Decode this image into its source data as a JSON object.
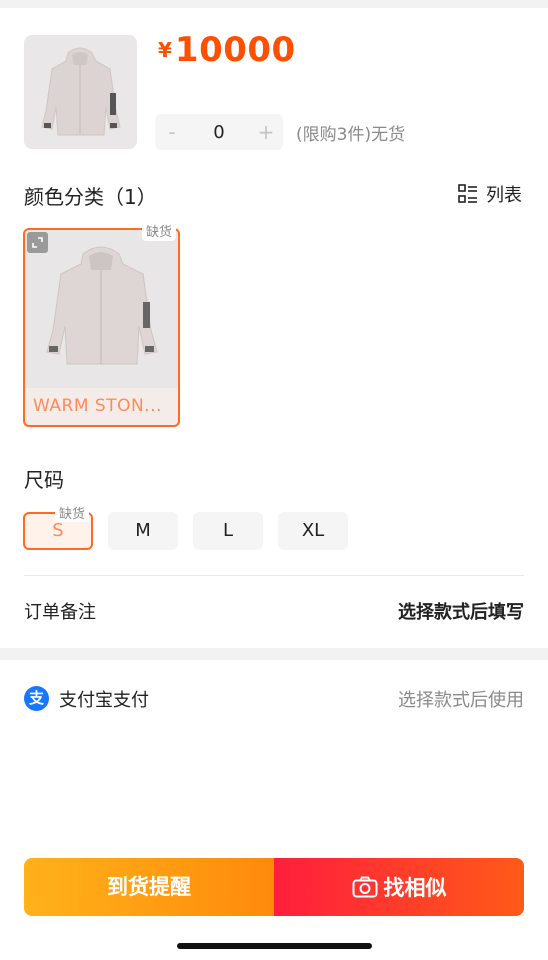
{
  "product": {
    "currency_symbol": "¥",
    "price": "10000",
    "quantity": "0",
    "minus": "-",
    "plus": "+",
    "limit_text": "(限购3件)无货",
    "image_icon": "jacket-thumbnail"
  },
  "color_section": {
    "title": "颜色分类（1）",
    "list_toggle_label": "列表",
    "list_icon": "list-view-icon",
    "items": [
      {
        "label": "WARM STON...",
        "badge": "缺货",
        "selected": true
      }
    ]
  },
  "size_section": {
    "title": "尺码",
    "out_of_stock_badge": "缺货",
    "sizes": [
      {
        "label": "S",
        "selected": true
      },
      {
        "label": "M",
        "selected": false
      },
      {
        "label": "L",
        "selected": false
      },
      {
        "label": "XL",
        "selected": false
      }
    ]
  },
  "order_note": {
    "label": "订单备注",
    "value": "选择款式后填写"
  },
  "payment": {
    "icon_glyph": "支",
    "label": "支付宝支付",
    "hint": "选择款式后使用"
  },
  "actions": {
    "notify_label": "到货提醒",
    "similar_label": "找相似"
  },
  "colors": {
    "accent": "#ff5000",
    "selected_border": "#ff6a24",
    "alipay_blue": "#1677ff",
    "notify_gradient": [
      "#ffb21a",
      "#ff8a0c"
    ],
    "similar_gradient": [
      "#ff1e3d",
      "#ff5a18"
    ]
  }
}
